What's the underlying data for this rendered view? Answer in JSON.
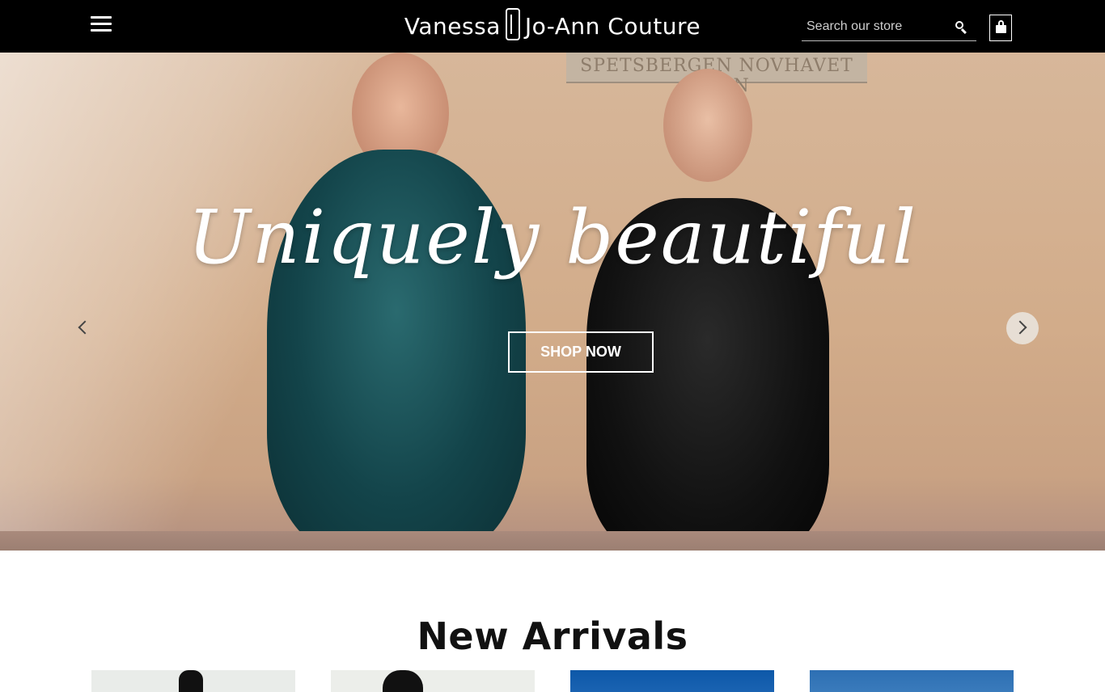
{
  "header": {
    "brand_left": "Vanessa",
    "brand_right": "Jo-Ann Couture",
    "search_placeholder": "Search our store"
  },
  "hero": {
    "plaque_text": "SPETSBERGEN  NOVHAVET  VITON",
    "title": "Uniquely beautiful",
    "button_label": "SHOP NOW"
  },
  "new_arrivals": {
    "title": "New Arrivals",
    "product_count": 4
  },
  "colors": {
    "header_bg": "#000000",
    "accent_text": "#ffffff"
  },
  "icons": {
    "menu": "hamburger-icon",
    "search": "search-icon",
    "cart": "shopping-bag-icon",
    "prev": "chevron-left-icon",
    "next": "chevron-right-icon"
  }
}
